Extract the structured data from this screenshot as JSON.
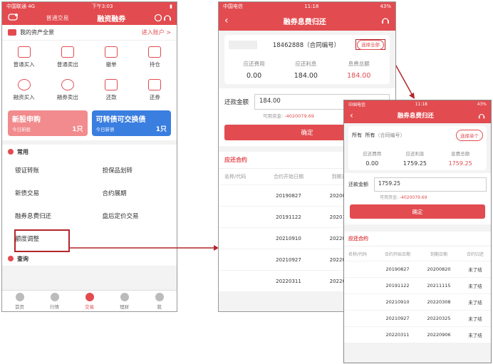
{
  "colors": {
    "accent": "#e24b4f",
    "highlight": "#b3262b",
    "blue": "#3a7ee0",
    "pink": "#f28b8d"
  },
  "phone1": {
    "status": {
      "carrier": "中国联通 4G",
      "time": "下午3:03"
    },
    "nav": {
      "tab": "普通交易",
      "title": "融资融券"
    },
    "assets": {
      "label": "我的资产全景",
      "link": "进入账户 >"
    },
    "grid": [
      {
        "label": "普通买入",
        "icon": "buy-icon"
      },
      {
        "label": "普通卖出",
        "icon": "sell-icon"
      },
      {
        "label": "撤单",
        "icon": "cancel-order-icon"
      },
      {
        "label": "持仓",
        "icon": "position-icon"
      },
      {
        "label": "融资买入",
        "icon": "margin-buy-icon"
      },
      {
        "label": "融券卖出",
        "icon": "short-sell-icon"
      },
      {
        "label": "还款",
        "icon": "repay-icon"
      },
      {
        "label": "还券",
        "icon": "return-stock-icon"
      }
    ],
    "banners": [
      {
        "title": "新股申购",
        "sub": "今日新股",
        "count": "1只"
      },
      {
        "title": "可转债可交换债",
        "sub": "今日新债",
        "count": "1只"
      }
    ],
    "common": {
      "title": "常用",
      "items": [
        "银证转账",
        "担保品划转",
        "新债交易",
        "合约展期",
        "融券息费归还",
        "盘后定价交易",
        "额度调整"
      ]
    },
    "query_title": "查询",
    "tabs": [
      "首页",
      "行情",
      "交易",
      "理财",
      "我"
    ]
  },
  "phone2": {
    "status": {
      "carrier": "中国电信",
      "time": "11:18",
      "battery": "43%"
    },
    "title": "融券息费归还",
    "contract_no": "18462888（合同编号）",
    "select_button": "选择全部",
    "fees": [
      {
        "label": "应还费用",
        "value": "0.00"
      },
      {
        "label": "应还利息",
        "value": "184.00"
      },
      {
        "label": "息费总额",
        "value": "184.00"
      }
    ],
    "repay_label": "还款金额",
    "repay_value": "184.00",
    "available": {
      "label": "可用资金:",
      "value": "-4020079.69"
    },
    "confirm": "确定",
    "table_title": "应还合约",
    "columns": [
      "名称/代码",
      "合约开始日期",
      "到期日"
    ],
    "rows": [
      [
        "",
        "20190827",
        "202008"
      ],
      [
        "",
        "20191122",
        "202011"
      ],
      [
        "",
        "20210910",
        "202203"
      ],
      [
        "",
        "20210927",
        "202203"
      ],
      [
        "",
        "20220311",
        "202203"
      ]
    ]
  },
  "phone3": {
    "status": {
      "carrier": "中国电信",
      "time": "11:18",
      "battery": "43%"
    },
    "title": "融券息费归还",
    "contract": {
      "all1": "所有",
      "all2": "所有",
      "no": "（合同编号）"
    },
    "select_button": "选择单个",
    "fees": [
      {
        "label": "应还费用",
        "value": "0.00"
      },
      {
        "label": "应还利息",
        "value": "1759.25"
      },
      {
        "label": "息费总额",
        "value": "1759.25"
      }
    ],
    "repay_label": "还款金额",
    "repay_value": "1759.25",
    "available": {
      "label": "可用资金:",
      "value": "-4020079.69"
    },
    "confirm": "确定",
    "table_title": "应还合约",
    "columns": [
      "名称/代码",
      "合约开始日期",
      "到期日期",
      "合约归还"
    ],
    "rows": [
      [
        "",
        "20190827",
        "20200820",
        "未了结"
      ],
      [
        "",
        "20191122",
        "20211115",
        "未了结"
      ],
      [
        "",
        "20210910",
        "20220308",
        "未了结"
      ],
      [
        "",
        "20210927",
        "20220325",
        "未了结"
      ],
      [
        "",
        "20220311",
        "20220906",
        "未了结"
      ]
    ]
  }
}
